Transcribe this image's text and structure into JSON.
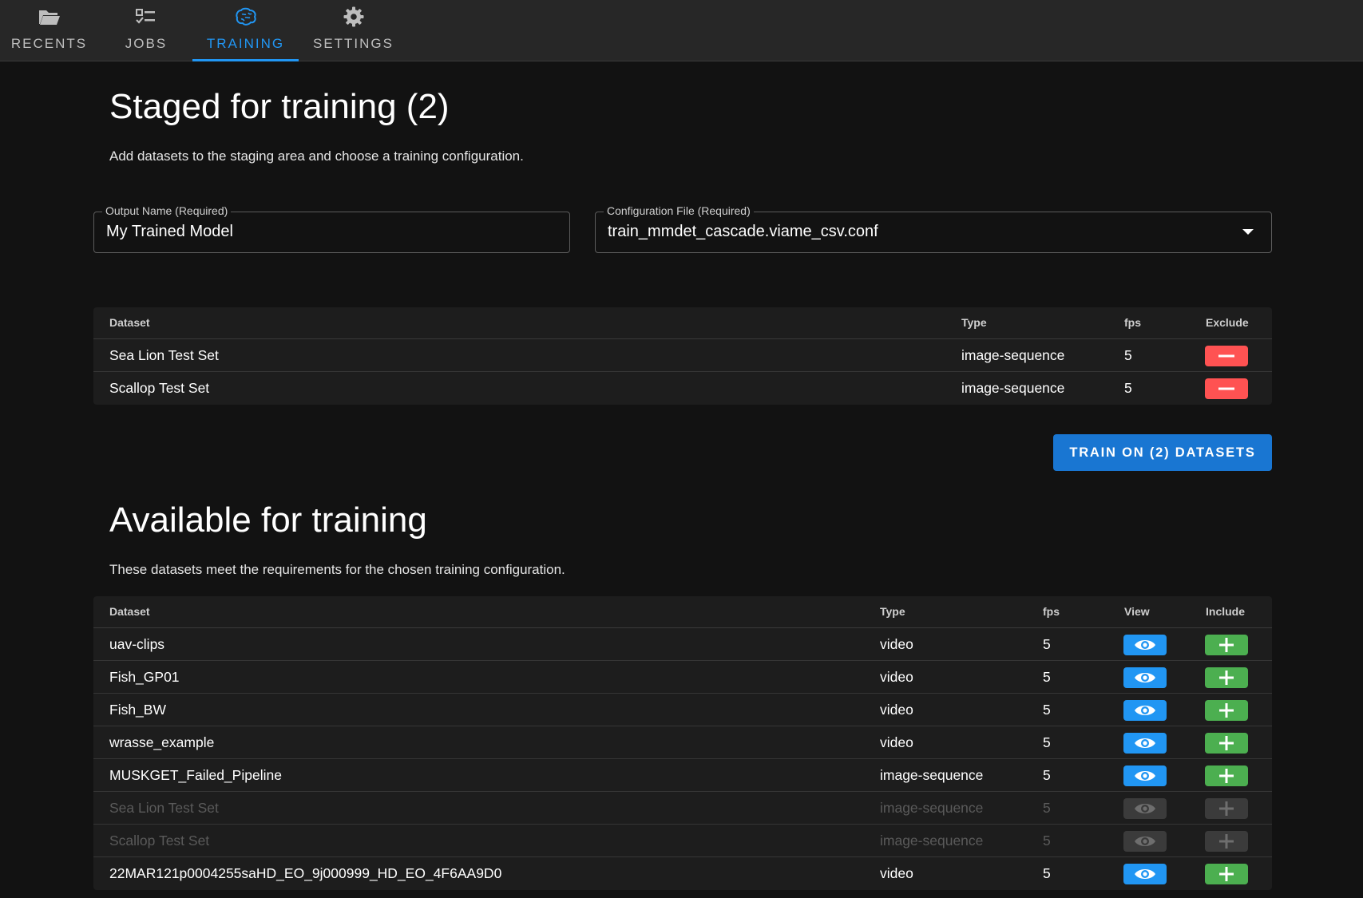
{
  "nav": {
    "tabs": [
      {
        "label": "RECENTS",
        "icon": "folder-open-icon",
        "active": false
      },
      {
        "label": "JOBS",
        "icon": "list-status-icon",
        "active": false
      },
      {
        "label": "TRAINING",
        "icon": "brain-icon",
        "active": true
      },
      {
        "label": "SETTINGS",
        "icon": "gear-icon",
        "active": false
      }
    ]
  },
  "staged": {
    "title": "Staged for training (2)",
    "description": "Add datasets to the staging area and choose a training configuration.",
    "output_name": {
      "label": "Output Name (Required)",
      "value": "My Trained Model"
    },
    "config_file": {
      "label": "Configuration File (Required)",
      "value": "train_mmdet_cascade.viame_csv.conf"
    },
    "columns": {
      "dataset": "Dataset",
      "type": "Type",
      "fps": "fps",
      "exclude": "Exclude"
    },
    "rows": [
      {
        "dataset": "Sea Lion Test Set",
        "type": "image-sequence",
        "fps": "5"
      },
      {
        "dataset": "Scallop Test Set",
        "type": "image-sequence",
        "fps": "5"
      }
    ],
    "train_button": "TRAIN ON (2) DATASETS"
  },
  "available": {
    "title": "Available for training",
    "description": "These datasets meet the requirements for the chosen training configuration.",
    "columns": {
      "dataset": "Dataset",
      "type": "Type",
      "fps": "fps",
      "view": "View",
      "include": "Include"
    },
    "rows": [
      {
        "dataset": "uav-clips",
        "type": "video",
        "fps": "5",
        "disabled": false
      },
      {
        "dataset": "Fish_GP01",
        "type": "video",
        "fps": "5",
        "disabled": false
      },
      {
        "dataset": "Fish_BW",
        "type": "video",
        "fps": "5",
        "disabled": false
      },
      {
        "dataset": "wrasse_example",
        "type": "video",
        "fps": "5",
        "disabled": false
      },
      {
        "dataset": "MUSKGET_Failed_Pipeline",
        "type": "image-sequence",
        "fps": "5",
        "disabled": false
      },
      {
        "dataset": "Sea Lion Test Set",
        "type": "image-sequence",
        "fps": "5",
        "disabled": true
      },
      {
        "dataset": "Scallop Test Set",
        "type": "image-sequence",
        "fps": "5",
        "disabled": true
      },
      {
        "dataset": "22MAR121p0004255saHD_EO_9j000999_HD_EO_4F6AA9D0",
        "type": "video",
        "fps": "5",
        "disabled": false
      }
    ]
  },
  "colors": {
    "accent": "#2196f3",
    "exclude": "#ff5252",
    "include": "#4caf50",
    "train_button": "#1976d2"
  }
}
